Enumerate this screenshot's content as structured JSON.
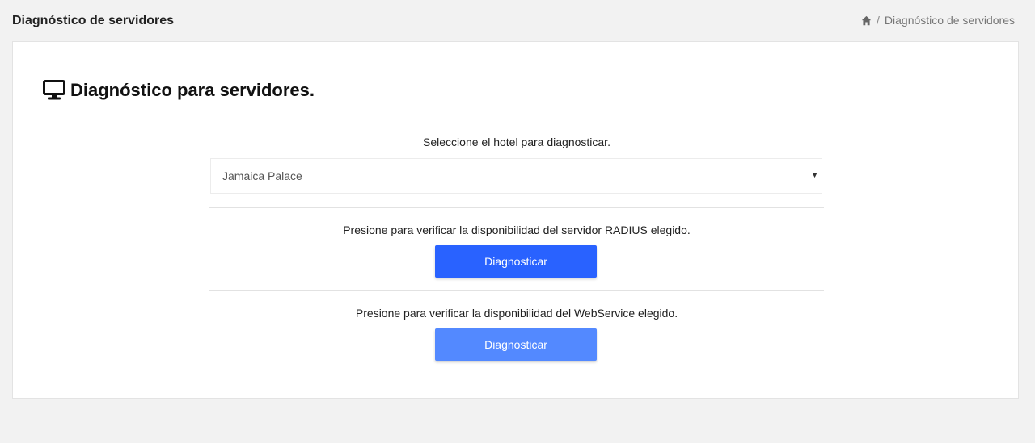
{
  "header": {
    "title": "Diagnóstico de servidores",
    "breadcrumb": {
      "home_icon": "home-icon",
      "separator": "/",
      "current": "Diagnóstico de servidores"
    }
  },
  "card": {
    "heading_icon": "monitor-icon",
    "heading": "Diagnóstico para servidores.",
    "hotel_select": {
      "prompt": "Seleccione el hotel para diagnosticar.",
      "selected": "Jamaica Palace",
      "caret": "▼"
    },
    "radius": {
      "prompt": "Presione para verificar la disponibilidad del servidor RADIUS elegido.",
      "button_label": "Diagnosticar"
    },
    "webservice": {
      "prompt": "Presione para verificar la disponibilidad del WebService elegido.",
      "button_label": "Diagnosticar"
    }
  },
  "colors": {
    "primary_button": "#2962ff",
    "secondary_button": "#5389ff",
    "background": "#f2f2f2"
  }
}
